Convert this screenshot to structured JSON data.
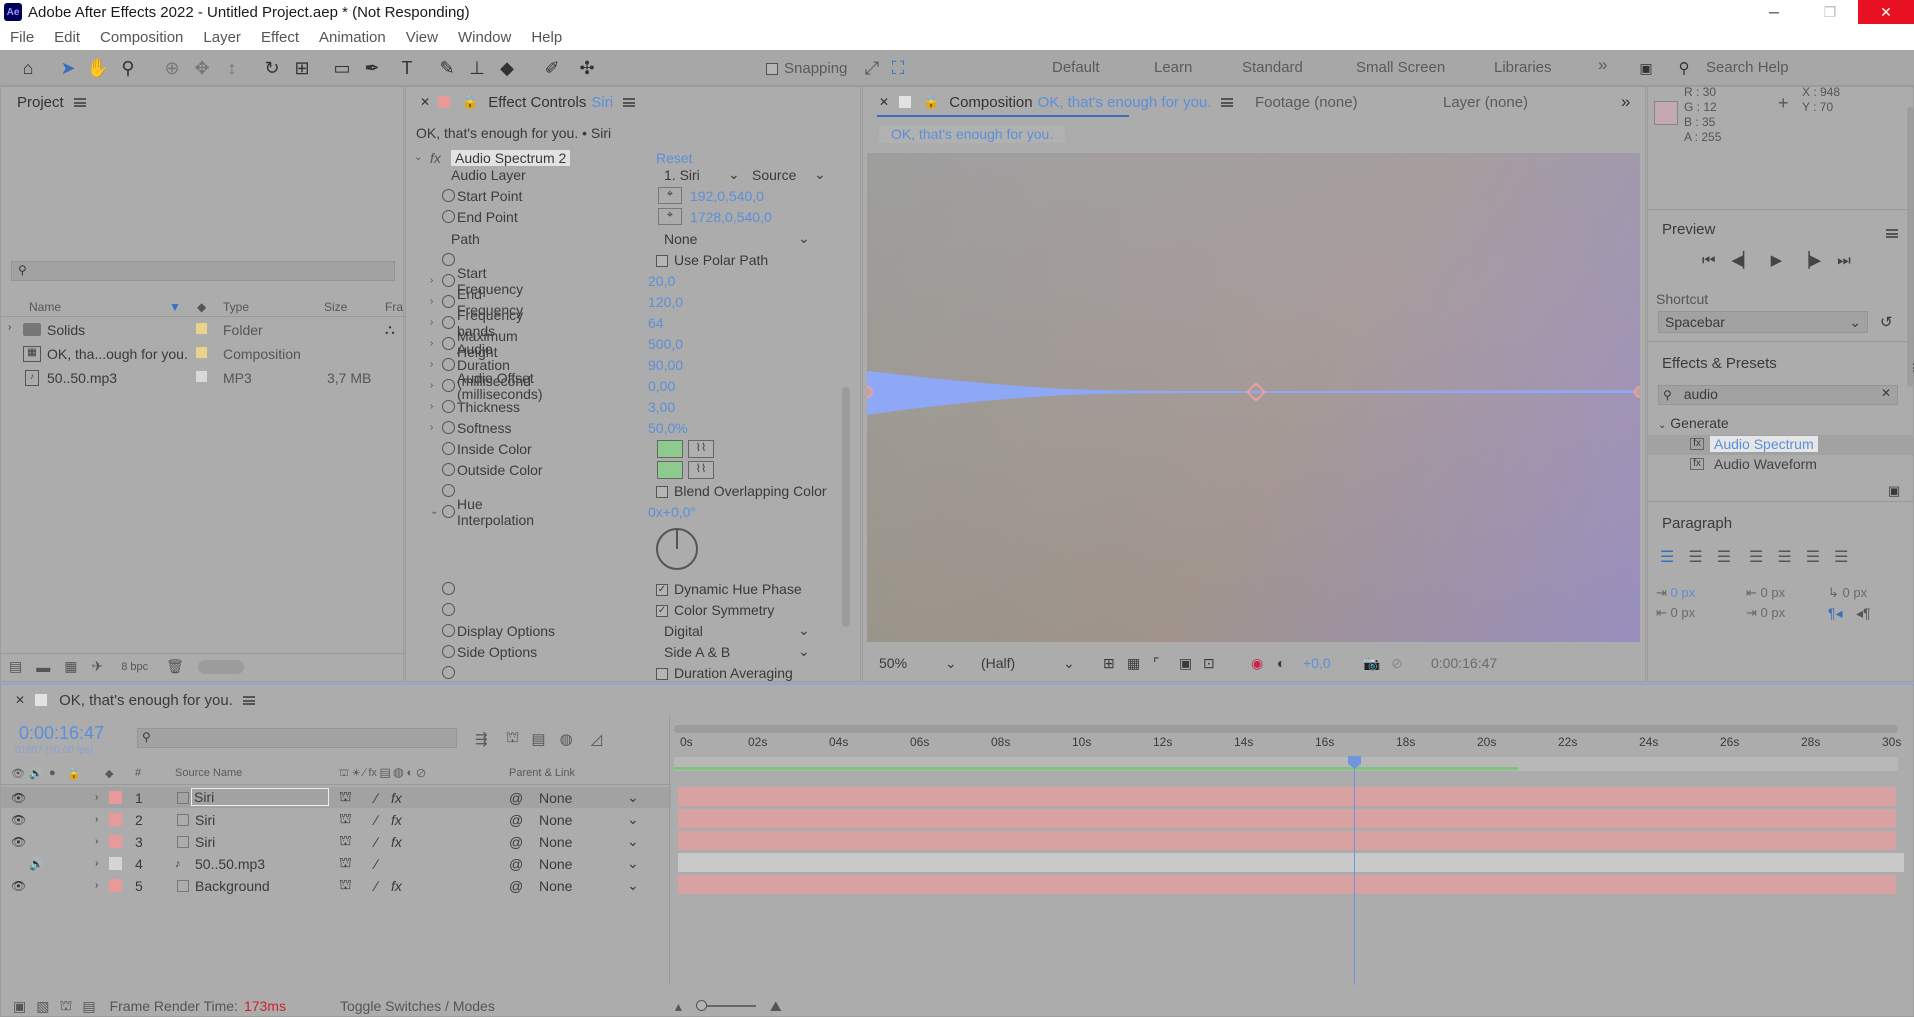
{
  "window": {
    "title": "Adobe After Effects 2022 - Untitled Project.aep * (Not Responding)",
    "logo": "Ae",
    "minimize": "─",
    "maximize": "❐",
    "close": "✕"
  },
  "menu": [
    "File",
    "Edit",
    "Composition",
    "Layer",
    "Effect",
    "Animation",
    "View",
    "Window",
    "Help"
  ],
  "toolbar": {
    "snapping": "Snapping",
    "workspaces": [
      "Default",
      "Learn",
      "Standard",
      "Small Screen",
      "Libraries"
    ],
    "more": "»",
    "search_placeholder": "Search Help"
  },
  "project": {
    "title": "Project",
    "search_placeholder": "",
    "columns": [
      "Name",
      "Type",
      "Size",
      "Fra"
    ],
    "items": [
      {
        "name": "Solids",
        "type": "Folder",
        "size": "",
        "color": "#e8d38c"
      },
      {
        "name": "OK, tha...ough for you.",
        "type": "Composition",
        "size": "",
        "color": "#e8d38c"
      },
      {
        "name": "50..50.mp3",
        "type": "MP3",
        "size": "3,7 MB",
        "color": "#d0d0d0"
      }
    ],
    "bpc": "8 bpc"
  },
  "effect_controls": {
    "tab": "Effect Controls",
    "tab_layer": "Siri",
    "breadcrumb": "OK, that's enough for you. • Siri",
    "effect_name": "Audio Spectrum 2",
    "reset": "Reset",
    "audio_layer_label": "Audio Layer",
    "audio_layer_value": "1. Siri",
    "audio_layer_source": "Source",
    "start_point_label": "Start Point",
    "start_point": "192,0,540,0",
    "end_point_label": "End Point",
    "end_point": "1728,0,540,0",
    "path_label": "Path",
    "path_value": "None",
    "use_polar": "Use Polar Path",
    "start_freq_label": "Start Frequency",
    "start_freq": "20,0",
    "end_freq_label": "End Frequency",
    "end_freq": "120,0",
    "bands_label": "Frequency bands",
    "bands": "64",
    "max_height_label": "Maximum Height",
    "max_height": "500,0",
    "duration_label": "Audio Duration (millisecond",
    "duration": "90,00",
    "offset_label": "Audio Offset (milliseconds)",
    "offset": "0,00",
    "thickness_label": "Thickness",
    "thickness": "3,00",
    "softness_label": "Softness",
    "softness": "50,0%",
    "inside_label": "Inside Color",
    "outside_label": "Outside Color",
    "blend": "Blend Overlapping Color",
    "hue_label": "Hue Interpolation",
    "hue": "0x+0,0°",
    "dyn_hue": "Dynamic Hue Phase",
    "color_sym": "Color Symmetry",
    "display_label": "Display Options",
    "display_value": "Digital",
    "side_label": "Side Options",
    "side_value": "Side A & B",
    "dur_avg": "Duration Averaging"
  },
  "composition": {
    "tab": "Composition",
    "comp_name": "OK, that's enough for you.",
    "footage": "Footage  (none)",
    "layer": "Layer  (none)",
    "breadcrumb": "OK, that's enough for you.",
    "zoom": "50%",
    "res": "(Half)",
    "exposure": "+0,0",
    "timecode": "0:00:16:47"
  },
  "info": {
    "r": "R : 30",
    "g": "G : 12",
    "b": "B : 35",
    "a": "A : 255",
    "x": "X : 948",
    "y": "Y : 70"
  },
  "preview": {
    "title": "Preview",
    "shortcut_label": "Shortcut",
    "shortcut": "Spacebar"
  },
  "effects_presets": {
    "title": "Effects & Presets",
    "search": "audio",
    "category": "Generate",
    "items": [
      "Audio Spectrum",
      "Audio Waveform"
    ]
  },
  "paragraph": {
    "title": "Paragraph",
    "v1": "0 px",
    "v2": "0 px",
    "v3": "0 px",
    "v4": "0 px",
    "v5": "0 px"
  },
  "timeline": {
    "comp": "OK, that's enough for you.",
    "timecode": "0:00:16:47",
    "fps": "01007 (60.00 fps)",
    "headers": {
      "source": "Source Name",
      "parent": "Parent & Link",
      "num": "#"
    },
    "ruler": [
      "0s",
      "02s",
      "04s",
      "06s",
      "08s",
      "10s",
      "12s",
      "14s",
      "16s",
      "18s",
      "20s",
      "22s",
      "24s",
      "26s",
      "28s",
      "30s"
    ],
    "layers": [
      {
        "num": "1",
        "name": "Siri",
        "parent": "None",
        "color": "#e89a9a",
        "bar": "#d99c9c"
      },
      {
        "num": "2",
        "name": "Siri",
        "parent": "None",
        "color": "#e89a9a",
        "bar": "#d99c9c"
      },
      {
        "num": "3",
        "name": "Siri",
        "parent": "None",
        "color": "#e89a9a",
        "bar": "#d99c9c"
      },
      {
        "num": "4",
        "name": "50..50.mp3",
        "parent": "None",
        "color": "#d5d5d5",
        "bar": "#c8c8c8"
      },
      {
        "num": "5",
        "name": "Background",
        "parent": "None",
        "color": "#e89a9a",
        "bar": "#d99c9c"
      }
    ],
    "render_label": "Frame Render Time:",
    "render_time": "173ms",
    "toggle": "Toggle Switches / Modes"
  }
}
